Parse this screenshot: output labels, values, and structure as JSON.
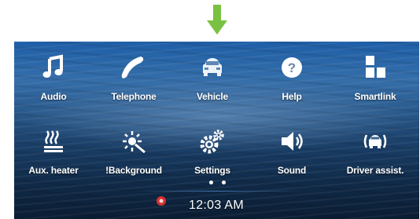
{
  "indicator": {
    "color": "#7ac142"
  },
  "tiles": [
    {
      "label": "Audio",
      "icon": "music-note-icon"
    },
    {
      "label": "Telephone",
      "icon": "phone-handset-icon"
    },
    {
      "label": "Vehicle",
      "icon": "car-icon"
    },
    {
      "label": "Help",
      "icon": "help-circle-icon"
    },
    {
      "label": "Smartlink",
      "icon": "smartlink-grid-icon"
    },
    {
      "label": "Aux. heater",
      "icon": "heater-icon"
    },
    {
      "label": "!Background",
      "icon": "brightness-tool-icon"
    },
    {
      "label": "Settings",
      "icon": "gears-icon"
    },
    {
      "label": "Sound",
      "icon": "speaker-icon"
    },
    {
      "label": "Driver assist.",
      "icon": "driver-assist-car-icon"
    }
  ],
  "pager": {
    "pages": 2,
    "current": 1
  },
  "status": {
    "time": "12:03 AM",
    "notification_color": "#d6322f"
  }
}
